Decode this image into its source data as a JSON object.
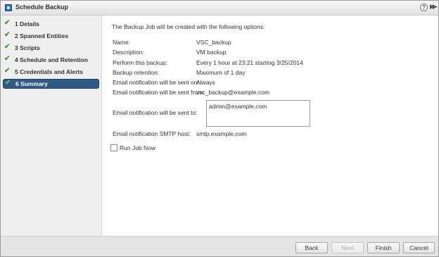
{
  "window": {
    "title": "Schedule Backup",
    "help_glyph": "?",
    "expand_glyph": "▶▶"
  },
  "steps": [
    {
      "number": "1",
      "label": "Details",
      "completed": true
    },
    {
      "number": "2",
      "label": "Spanned Entities",
      "completed": true
    },
    {
      "number": "3",
      "label": "Scripts",
      "completed": true
    },
    {
      "number": "4",
      "label": "Schedule and Retention",
      "completed": true
    },
    {
      "number": "5",
      "label": "Credentials and Alerts",
      "completed": true
    },
    {
      "number": "6",
      "label": "Summary",
      "completed": true,
      "active": true
    }
  ],
  "step_labels": [
    "1  Details",
    "2  Spanned Entities",
    "3  Scripts",
    "4  Schedule and Retention",
    "5  Credentials and Alerts",
    "6  Summary"
  ],
  "check_glyph": "✔",
  "summary": {
    "intro": "The Backup Job will be created with the following options:",
    "rows": [
      {
        "label": "Name:",
        "value": "VSC_backup"
      },
      {
        "label": "Description:",
        "value": "VM backup"
      },
      {
        "label": "Perform this backup:",
        "value": "Every 1 hour at 23:21  starting  3/25/2014"
      },
      {
        "label": "Backup retention:",
        "value": "Maximum of 1 day"
      },
      {
        "label": "Email notification will be sent on:",
        "value": "Always"
      },
      {
        "label": "Email notification will be sent from:",
        "value": "vsc_backup@example.com"
      },
      {
        "label": "Email notification will be sent to:",
        "value": "admin@example.com"
      },
      {
        "label": "Email notification SMTP host:",
        "value": "smtp.example.com"
      }
    ],
    "run_now_label": "Run Job Now",
    "run_now_checked": false
  },
  "footer": {
    "back_label": "Back",
    "next_label": "Next",
    "finish_label": "Finish",
    "cancel_label": "Cancel"
  },
  "colors": {
    "active_step_bg": "#2f5a85",
    "check_green": "#3a9a36",
    "sidebar_bg": "#efefef",
    "footer_bg": "#e4e4e4"
  }
}
